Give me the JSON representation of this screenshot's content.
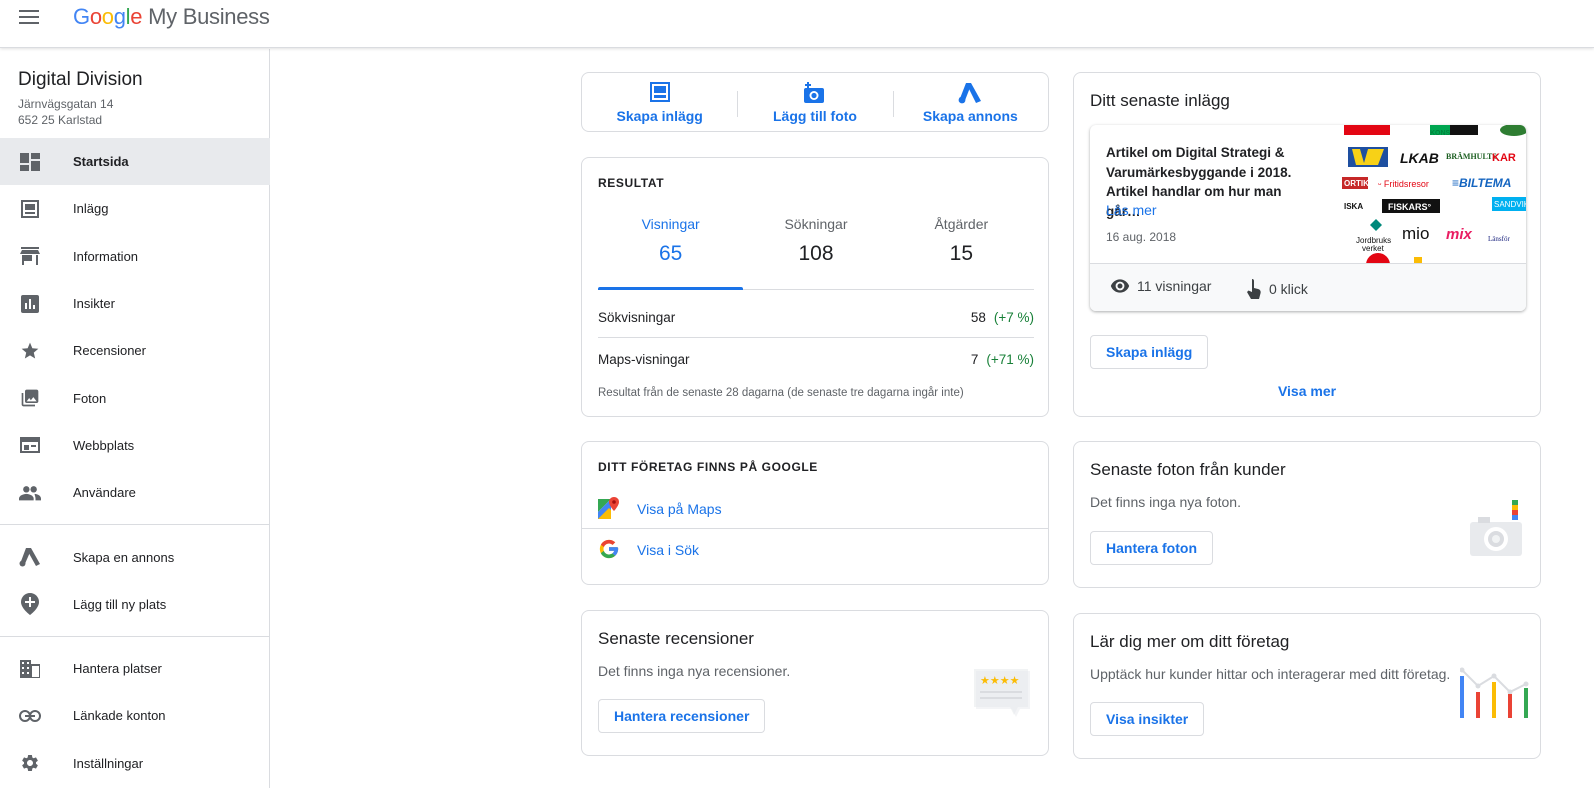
{
  "header": {
    "logo_letters": [
      "G",
      "o",
      "o",
      "g",
      "l",
      "e"
    ],
    "product": "My Business"
  },
  "business": {
    "name": "Digital Division",
    "address_line1": "Järnvägsgatan 14",
    "address_line2": "652 25 Karlstad"
  },
  "sidebar": {
    "items": [
      {
        "label": "Startsida",
        "icon": "dashboard-icon"
      },
      {
        "label": "Inlägg",
        "icon": "posts-icon"
      },
      {
        "label": "Information",
        "icon": "storefront-icon"
      },
      {
        "label": "Insikter",
        "icon": "bar-chart-icon"
      },
      {
        "label": "Recensioner",
        "icon": "star-icon"
      },
      {
        "label": "Foton",
        "icon": "photo-library-icon"
      },
      {
        "label": "Webbplats",
        "icon": "web-icon"
      },
      {
        "label": "Användare",
        "icon": "people-icon"
      },
      {
        "label": "Skapa en annons",
        "icon": "google-ads-icon"
      },
      {
        "label": "Lägg till ny plats",
        "icon": "add-location-icon"
      },
      {
        "label": "Hantera platser",
        "icon": "buildings-icon"
      },
      {
        "label": "Länkade konton",
        "icon": "link-icon"
      },
      {
        "label": "Inställningar",
        "icon": "gear-icon"
      }
    ]
  },
  "quick_actions": {
    "create_post": "Skapa inlägg",
    "add_photo": "Lägg till foto",
    "create_ad": "Skapa annons"
  },
  "results": {
    "title": "RESULTAT",
    "tabs": [
      {
        "label": "Visningar",
        "value": "65"
      },
      {
        "label": "Sökningar",
        "value": "108"
      },
      {
        "label": "Åtgärder",
        "value": "15"
      }
    ],
    "rows": [
      {
        "label": "Sökvisningar",
        "value": "58",
        "delta": "(+7 %)"
      },
      {
        "label": "Maps-visningar",
        "value": "7",
        "delta": "(+71 %)"
      }
    ],
    "footnote": "Resultat från de senaste 28 dagarna (de senaste tre dagarna ingår inte)"
  },
  "on_google": {
    "title": "DITT FÖRETAG FINNS PÅ GOOGLE",
    "maps_link": "Visa på Maps",
    "search_link": "Visa i Sök"
  },
  "reviews": {
    "title": "Senaste recensioner",
    "empty": "Det finns inga nya recensioner.",
    "button": "Hantera recensioner"
  },
  "latest_post": {
    "title": "Ditt senaste inlägg",
    "text": "Artikel om Digital Strategi & Varumärkesbyggande i 2018. Artikel handlar om hur man går…",
    "read_more": "Läs mer",
    "date": "16 aug. 2018",
    "views": "11 visningar",
    "clicks": "0 klick",
    "create_button": "Skapa inlägg",
    "show_more": "Visa mer",
    "image_logos": [
      "KONSUM",
      "LKAB",
      "BRÄMHULTS",
      "ORTIK",
      "Fritidsresor",
      "BILTEMA",
      "ISKA",
      "FISKARS",
      "SANDVIK",
      "Jordbruks verket",
      "mio",
      "mix",
      "Länsförs"
    ]
  },
  "photos": {
    "title": "Senaste foton från kunder",
    "empty": "Det finns inga nya foton.",
    "button": "Hantera foton"
  },
  "learn": {
    "title": "Lär dig mer om ditt företag",
    "text": "Upptäck hur kunder hittar och interagerar med ditt företag.",
    "button": "Visa insikter"
  },
  "colors": {
    "accent": "#1a73e8",
    "positive": "#188038",
    "active_nav_bg": "#e8eaed"
  }
}
